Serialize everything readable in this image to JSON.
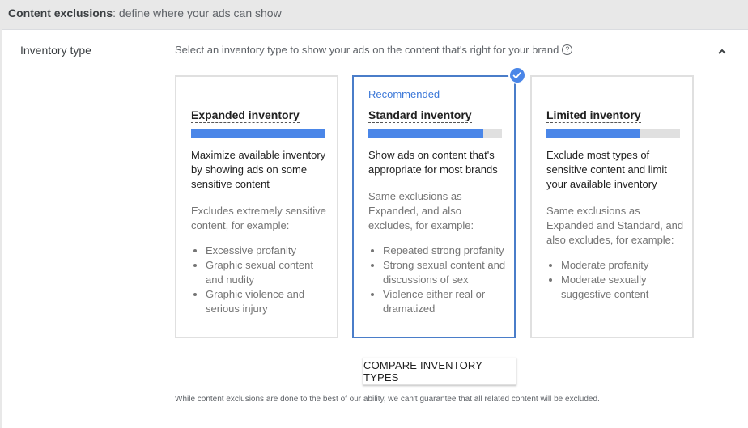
{
  "header": {
    "title_bold": "Content exclusions",
    "title_rest": ": define where your ads can show"
  },
  "section": {
    "label": "Inventory type",
    "description": "Select an inventory type to show your ads on the content that's right for your brand",
    "help_icon": "question-circle-icon",
    "collapse_icon": "chevron-up-icon"
  },
  "cards": [
    {
      "badge": "",
      "title": "Expanded inventory",
      "fill_fraction": 1.0,
      "description": "Maximize available inventory by showing ads on some sensitive content",
      "exclusions_intro": "Excludes extremely sensitive content, for example:",
      "examples": [
        "Excessive profanity",
        "Graphic sexual content and nudity",
        "Graphic violence and serious injury"
      ]
    },
    {
      "badge": "Recommended",
      "title": "Standard inventory",
      "fill_fraction": 0.86,
      "description": "Show ads on content that's appropriate for most brands",
      "exclusions_intro": "Same exclusions as Expanded, and also excludes, for example:",
      "examples": [
        "Repeated strong profanity",
        "Strong sexual content and discussions of sex",
        "Violence either real or dramatized"
      ]
    },
    {
      "badge": "",
      "title": "Limited inventory",
      "fill_fraction": 0.7,
      "description": "Exclude most types of sensitive content and limit your available inventory",
      "exclusions_intro": "Same exclusions as Expanded and Standard, and also excludes, for example:",
      "examples": [
        "Moderate profanity",
        "Moderate sexually suggestive content"
      ]
    }
  ],
  "selected_card": "Standard inventory",
  "compare_button": "COMPARE INVENTORY TYPES",
  "footnote": "While content exclusions are done to the best of our ability, we can't guarantee that all related content will be excluded.",
  "colors": {
    "accent": "#4a86e8",
    "selected_border": "#4a7dc9",
    "bar_track": "#e0e0e0"
  }
}
